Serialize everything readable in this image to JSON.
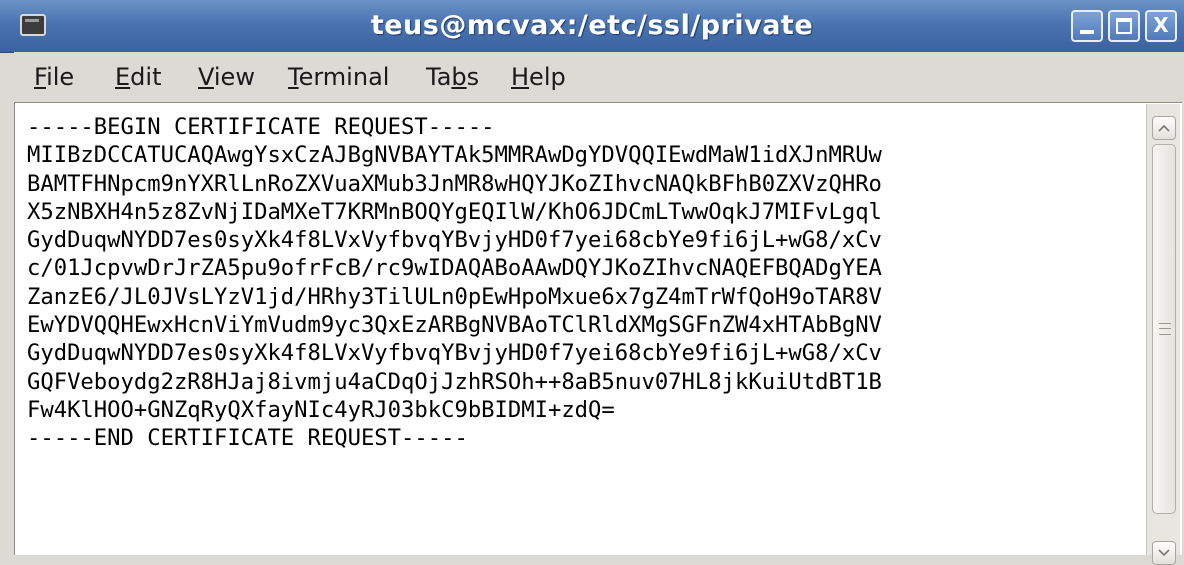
{
  "window": {
    "title": "teus@mcvax:/etc/ssl/private",
    "minimize_icon": "minimize-icon",
    "maximize_icon": "maximize-icon",
    "close_icon": "close-icon",
    "close_label": "X"
  },
  "menu": {
    "items": [
      {
        "mnemonic": "F",
        "rest": "ile"
      },
      {
        "mnemonic": "E",
        "rest": "dit"
      },
      {
        "mnemonic": "V",
        "rest": "iew"
      },
      {
        "mnemonic": "T",
        "rest": "erminal"
      },
      {
        "pre": "Ta",
        "mnemonic": "b",
        "rest": "s"
      },
      {
        "mnemonic": "H",
        "rest": "elp"
      }
    ]
  },
  "terminal": {
    "lines": [
      "-----BEGIN CERTIFICATE REQUEST-----",
      "MIIBzDCCATUCAQAwgYsxCzAJBgNVBAYTAk5MMRAwDgYDVQQIEwdMaW1idXJnMRUw",
      "BAMTFHNpcm9nYXRlLnRoZXVuaXMub3JnMR8wHQYJKoZIhvcNAQkBFhB0ZXVzQHRo",
      "X5zNBXH4n5z8ZvNjIDaMXeT7KRMnBOQYgEQIlW/KhO6JDCmLTwwOqkJ7MIFvLgql",
      "GydDuqwNYDD7es0syXk4f8LVxVyfbvqYBvjyHD0f7yei68cbYe9fi6jL+wG8/xCv",
      "c/01JcpvwDrJrZA5pu9ofrFcB/rc9wIDAQABoAAwDQYJKoZIhvcNAQEFBQADgYEA",
      "ZanzE6/JL0JVsLYzV1jd/HRhy3TilULn0pEwHpoMxue6x7gZ4mTrWfQoH9oTAR8V",
      "EwYDVQQHEwxHcnViYmVudm9yc3QxEzARBgNVBAoTClRldXMgSGFnZW4xHTAbBgNV",
      "GydDuqwNYDD7es0syXk4f8LVxVyfbvqYBvjyHD0f7yei68cbYe9fi6jL+wG8/xCv",
      "GQFVeboydg2zR8HJaj8ivmju4aCDqOjJzhRSOh++8aB5nuv07HL8jkKuiUtdBT1B",
      "Fw4KlHOO+GNZqRyQXfayNIc4yRJ03bkC9bBIDMI+zdQ=",
      "-----END CERTIFICATE REQUEST-----"
    ]
  }
}
